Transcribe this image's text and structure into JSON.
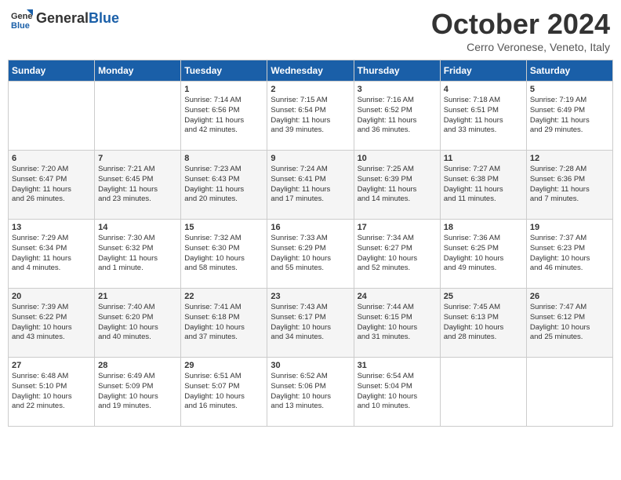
{
  "logo": {
    "general": "General",
    "blue": "Blue"
  },
  "header": {
    "month": "October 2024",
    "location": "Cerro Veronese, Veneto, Italy"
  },
  "weekdays": [
    "Sunday",
    "Monday",
    "Tuesday",
    "Wednesday",
    "Thursday",
    "Friday",
    "Saturday"
  ],
  "weeks": [
    [
      {
        "day": "",
        "lines": []
      },
      {
        "day": "",
        "lines": []
      },
      {
        "day": "1",
        "lines": [
          "Sunrise: 7:14 AM",
          "Sunset: 6:56 PM",
          "Daylight: 11 hours",
          "and 42 minutes."
        ]
      },
      {
        "day": "2",
        "lines": [
          "Sunrise: 7:15 AM",
          "Sunset: 6:54 PM",
          "Daylight: 11 hours",
          "and 39 minutes."
        ]
      },
      {
        "day": "3",
        "lines": [
          "Sunrise: 7:16 AM",
          "Sunset: 6:52 PM",
          "Daylight: 11 hours",
          "and 36 minutes."
        ]
      },
      {
        "day": "4",
        "lines": [
          "Sunrise: 7:18 AM",
          "Sunset: 6:51 PM",
          "Daylight: 11 hours",
          "and 33 minutes."
        ]
      },
      {
        "day": "5",
        "lines": [
          "Sunrise: 7:19 AM",
          "Sunset: 6:49 PM",
          "Daylight: 11 hours",
          "and 29 minutes."
        ]
      }
    ],
    [
      {
        "day": "6",
        "lines": [
          "Sunrise: 7:20 AM",
          "Sunset: 6:47 PM",
          "Daylight: 11 hours",
          "and 26 minutes."
        ]
      },
      {
        "day": "7",
        "lines": [
          "Sunrise: 7:21 AM",
          "Sunset: 6:45 PM",
          "Daylight: 11 hours",
          "and 23 minutes."
        ]
      },
      {
        "day": "8",
        "lines": [
          "Sunrise: 7:23 AM",
          "Sunset: 6:43 PM",
          "Daylight: 11 hours",
          "and 20 minutes."
        ]
      },
      {
        "day": "9",
        "lines": [
          "Sunrise: 7:24 AM",
          "Sunset: 6:41 PM",
          "Daylight: 11 hours",
          "and 17 minutes."
        ]
      },
      {
        "day": "10",
        "lines": [
          "Sunrise: 7:25 AM",
          "Sunset: 6:39 PM",
          "Daylight: 11 hours",
          "and 14 minutes."
        ]
      },
      {
        "day": "11",
        "lines": [
          "Sunrise: 7:27 AM",
          "Sunset: 6:38 PM",
          "Daylight: 11 hours",
          "and 11 minutes."
        ]
      },
      {
        "day": "12",
        "lines": [
          "Sunrise: 7:28 AM",
          "Sunset: 6:36 PM",
          "Daylight: 11 hours",
          "and 7 minutes."
        ]
      }
    ],
    [
      {
        "day": "13",
        "lines": [
          "Sunrise: 7:29 AM",
          "Sunset: 6:34 PM",
          "Daylight: 11 hours",
          "and 4 minutes."
        ]
      },
      {
        "day": "14",
        "lines": [
          "Sunrise: 7:30 AM",
          "Sunset: 6:32 PM",
          "Daylight: 11 hours",
          "and 1 minute."
        ]
      },
      {
        "day": "15",
        "lines": [
          "Sunrise: 7:32 AM",
          "Sunset: 6:30 PM",
          "Daylight: 10 hours",
          "and 58 minutes."
        ]
      },
      {
        "day": "16",
        "lines": [
          "Sunrise: 7:33 AM",
          "Sunset: 6:29 PM",
          "Daylight: 10 hours",
          "and 55 minutes."
        ]
      },
      {
        "day": "17",
        "lines": [
          "Sunrise: 7:34 AM",
          "Sunset: 6:27 PM",
          "Daylight: 10 hours",
          "and 52 minutes."
        ]
      },
      {
        "day": "18",
        "lines": [
          "Sunrise: 7:36 AM",
          "Sunset: 6:25 PM",
          "Daylight: 10 hours",
          "and 49 minutes."
        ]
      },
      {
        "day": "19",
        "lines": [
          "Sunrise: 7:37 AM",
          "Sunset: 6:23 PM",
          "Daylight: 10 hours",
          "and 46 minutes."
        ]
      }
    ],
    [
      {
        "day": "20",
        "lines": [
          "Sunrise: 7:39 AM",
          "Sunset: 6:22 PM",
          "Daylight: 10 hours",
          "and 43 minutes."
        ]
      },
      {
        "day": "21",
        "lines": [
          "Sunrise: 7:40 AM",
          "Sunset: 6:20 PM",
          "Daylight: 10 hours",
          "and 40 minutes."
        ]
      },
      {
        "day": "22",
        "lines": [
          "Sunrise: 7:41 AM",
          "Sunset: 6:18 PM",
          "Daylight: 10 hours",
          "and 37 minutes."
        ]
      },
      {
        "day": "23",
        "lines": [
          "Sunrise: 7:43 AM",
          "Sunset: 6:17 PM",
          "Daylight: 10 hours",
          "and 34 minutes."
        ]
      },
      {
        "day": "24",
        "lines": [
          "Sunrise: 7:44 AM",
          "Sunset: 6:15 PM",
          "Daylight: 10 hours",
          "and 31 minutes."
        ]
      },
      {
        "day": "25",
        "lines": [
          "Sunrise: 7:45 AM",
          "Sunset: 6:13 PM",
          "Daylight: 10 hours",
          "and 28 minutes."
        ]
      },
      {
        "day": "26",
        "lines": [
          "Sunrise: 7:47 AM",
          "Sunset: 6:12 PM",
          "Daylight: 10 hours",
          "and 25 minutes."
        ]
      }
    ],
    [
      {
        "day": "27",
        "lines": [
          "Sunrise: 6:48 AM",
          "Sunset: 5:10 PM",
          "Daylight: 10 hours",
          "and 22 minutes."
        ]
      },
      {
        "day": "28",
        "lines": [
          "Sunrise: 6:49 AM",
          "Sunset: 5:09 PM",
          "Daylight: 10 hours",
          "and 19 minutes."
        ]
      },
      {
        "day": "29",
        "lines": [
          "Sunrise: 6:51 AM",
          "Sunset: 5:07 PM",
          "Daylight: 10 hours",
          "and 16 minutes."
        ]
      },
      {
        "day": "30",
        "lines": [
          "Sunrise: 6:52 AM",
          "Sunset: 5:06 PM",
          "Daylight: 10 hours",
          "and 13 minutes."
        ]
      },
      {
        "day": "31",
        "lines": [
          "Sunrise: 6:54 AM",
          "Sunset: 5:04 PM",
          "Daylight: 10 hours",
          "and 10 minutes."
        ]
      },
      {
        "day": "",
        "lines": []
      },
      {
        "day": "",
        "lines": []
      }
    ]
  ]
}
